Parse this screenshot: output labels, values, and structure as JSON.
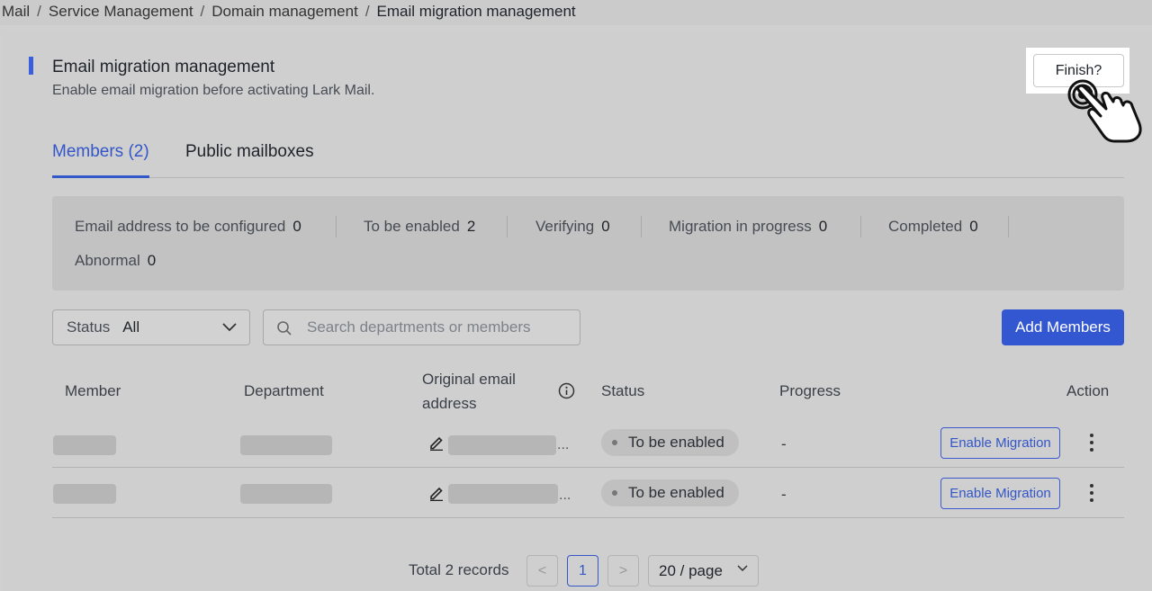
{
  "breadcrumb": {
    "items": [
      "Mail",
      "Service Management",
      "Domain management"
    ],
    "current": "Email migration management",
    "separator": "/"
  },
  "header": {
    "title": "Email migration management",
    "subtitle": "Enable email migration before activating Lark Mail.",
    "finish_label": "Finish?"
  },
  "tabs": [
    {
      "label": "Members (2)",
      "active": true
    },
    {
      "label": "Public mailboxes",
      "active": false
    }
  ],
  "stats": [
    {
      "label": "Email address to be configured",
      "value": "0"
    },
    {
      "label": "To be enabled",
      "value": "2"
    },
    {
      "label": "Verifying",
      "value": "0"
    },
    {
      "label": "Migration in progress",
      "value": "0"
    },
    {
      "label": "Completed",
      "value": "0"
    },
    {
      "label": "Abnormal",
      "value": "0"
    }
  ],
  "filters": {
    "status_label": "Status",
    "status_value": "All",
    "search_placeholder": "Search departments or members",
    "add_members_label": "Add Members"
  },
  "table": {
    "columns": {
      "member": "Member",
      "department": "Department",
      "original_email_line1": "Original email",
      "original_email_line2": "address",
      "status": "Status",
      "progress": "Progress",
      "action": "Action"
    },
    "rows": [
      {
        "email_suffix": "...",
        "status": "To be enabled",
        "progress": "-",
        "action": "Enable Migration"
      },
      {
        "email_suffix": "...",
        "status": "To be enabled",
        "progress": "-",
        "action": "Enable Migration"
      }
    ]
  },
  "pagination": {
    "total": "Total 2 records",
    "prev": "<",
    "current_page": "1",
    "next": ">",
    "page_size": "20 / page"
  },
  "colors": {
    "accent": "#3356d1",
    "background": "#d0d0d0"
  },
  "icons": [
    "search-icon",
    "chevron-down-icon",
    "info-icon",
    "edit-icon",
    "more-vertical-icon",
    "pointing-hand-icon"
  ]
}
